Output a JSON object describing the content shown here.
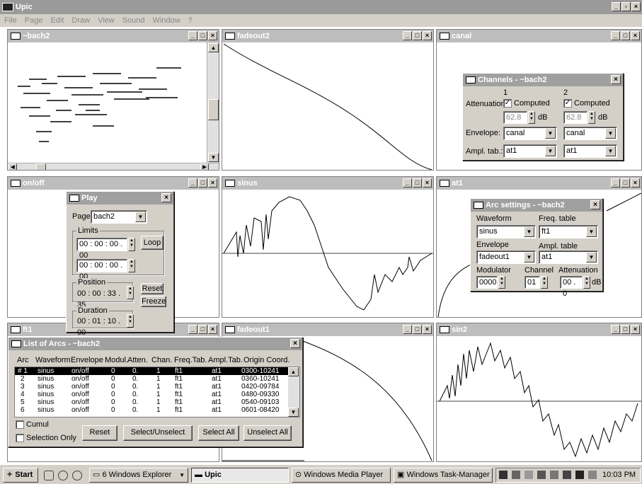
{
  "app": {
    "title": "Upic",
    "menu": [
      "File",
      "Page",
      "Edit",
      "Draw",
      "View",
      "Sound",
      "Window",
      "?"
    ]
  },
  "windows": {
    "bach2": "~bach2",
    "fadeout2": "fadeout2",
    "canal": "canal",
    "onoff": "on/off",
    "sinus": "sinus",
    "at1": "at1",
    "ft1": "ft1",
    "fadeout1": "fadeout1",
    "sin2": "sin2"
  },
  "channels": {
    "title": "Channels - ~bach2",
    "col1": "1",
    "col2": "2",
    "attenuation_label": "Attenuation:",
    "computed1": "Computed",
    "computed2": "Computed",
    "att1": "62.8",
    "att2": "62.8",
    "db1": "dB",
    "db2": "dB",
    "envelope_label": "Envelope:",
    "env1": "canal",
    "env2": "canal",
    "ampl_label": "Ampl. tab.:",
    "ampl1": "at1",
    "ampl2": "at1"
  },
  "play": {
    "title": "Play",
    "page_label": "Page",
    "page_value": "bach2",
    "limits_label": "Limits",
    "limit1": "00 : 00 : 00 . 00",
    "limit2": "00 : 00 : 00 . 00",
    "loop": "Loop",
    "position_label": "Position",
    "position": "00 : 00 : 33 . 35",
    "reset": "Reset",
    "freeze": "Freeze",
    "duration_label": "Duration",
    "duration": "00 : 01 : 10 . 00"
  },
  "arc": {
    "title": "Arc settings - ~bach2",
    "waveform_label": "Waveform",
    "waveform": "sinus",
    "freq_label": "Freq. table",
    "freq": "ft1",
    "envelope_label": "Envelope",
    "envelope": "fadeout1",
    "ampl_label": "Ampl. table",
    "ampl": "at1",
    "modulator_label": "Modulator",
    "modulator": "0000",
    "channel_label": "Channel",
    "channel": "01",
    "attenuation_label": "Attenuation",
    "attenuation": "00 . 0",
    "db": "dB"
  },
  "arcs": {
    "title": "List of Arcs - ~bach2",
    "headers": [
      "Arc",
      "Waveform",
      "Envelope",
      "Modul.",
      "Atten.",
      "Chan.",
      "Freq.Tab.",
      "Ampl.Tab.",
      "Origin Coord."
    ],
    "rows": [
      [
        "# 1",
        "sinus",
        "on/off",
        "0",
        "0.",
        "1",
        "ft1",
        "at1",
        "0300-10241"
      ],
      [
        "2",
        "sinus",
        "on/off",
        "0",
        "0.",
        "1",
        "ft1",
        "at1",
        "0360-10241"
      ],
      [
        "3",
        "sinus",
        "on/off",
        "0",
        "0.",
        "1",
        "ft1",
        "at1",
        "0420-09784"
      ],
      [
        "4",
        "sinus",
        "on/off",
        "0",
        "0.",
        "1",
        "ft1",
        "at1",
        "0480-09330"
      ],
      [
        "5",
        "sinus",
        "on/off",
        "0",
        "0.",
        "1",
        "ft1",
        "at1",
        "0540-09103"
      ],
      [
        "6",
        "sinus",
        "on/off",
        "0",
        "0.",
        "1",
        "ft1",
        "at1",
        "0601-08420"
      ]
    ],
    "cumul": "Cumul",
    "selection_only": "Selection Only",
    "reset": "Reset",
    "select_unselect": "Select/Unselect",
    "select_all": "Select All",
    "unselect_all": "Unselect All"
  },
  "taskbar": {
    "start": "Start",
    "explorer": "6 Windows Explorer",
    "upic": "Upic",
    "media": "Windows Media Player",
    "taskmgr": "Windows Task-Manager",
    "clock": "10:03 PM"
  }
}
